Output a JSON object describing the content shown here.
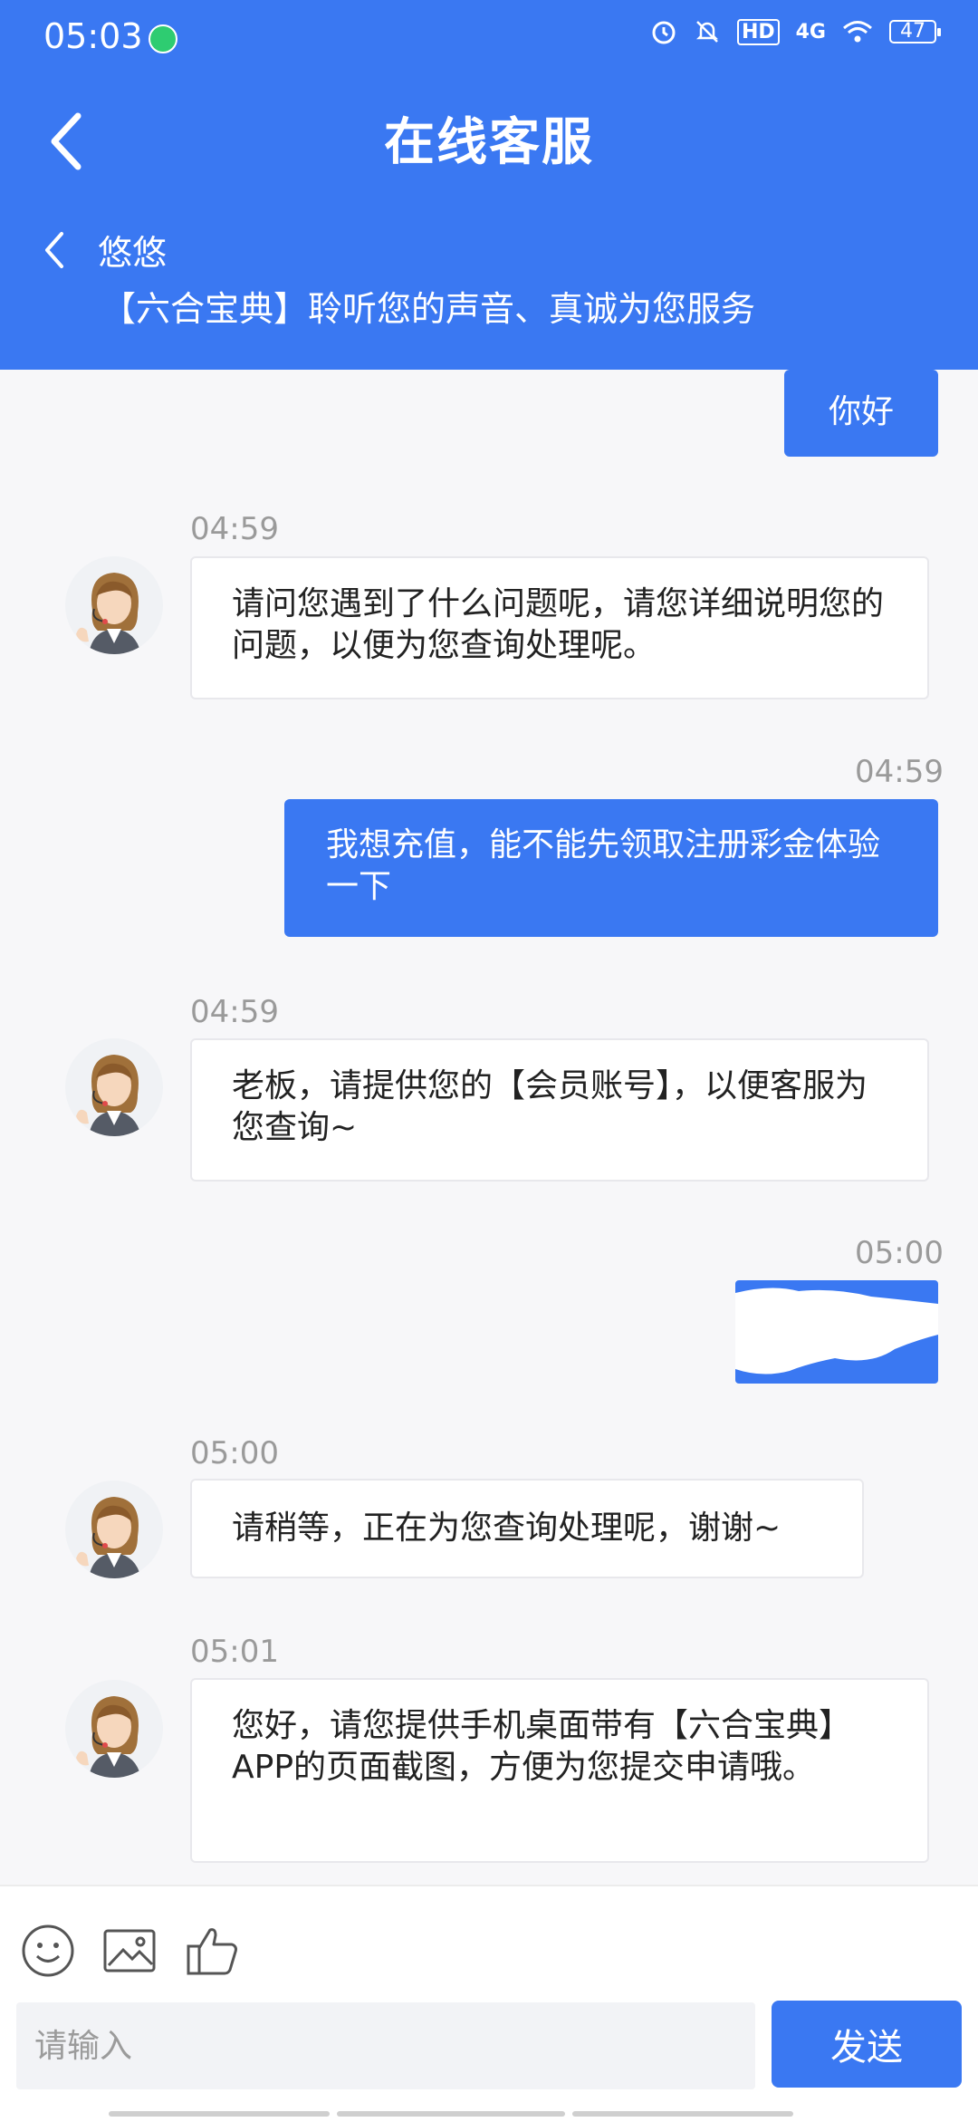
{
  "status_bar": {
    "time": "05:03",
    "battery": "47",
    "icons": [
      "alarm-icon",
      "mute-icon",
      "hd-icon",
      "signal-4g-icon",
      "wifi-icon",
      "battery-icon"
    ],
    "hd_label": "HD",
    "network_label": "4G"
  },
  "header": {
    "title": "在线客服",
    "agent_name": "悠悠",
    "tagline": "【六合宝典】聆听您的声音、真诚为您服务",
    "color": "#3a78f2"
  },
  "messages": [
    {
      "side": "out",
      "text": "你好"
    },
    {
      "side": "in",
      "time": "04:59",
      "text": "请问您遇到了什么问题呢，请您详细说明您的问题，以便为您查询处理呢。"
    },
    {
      "side": "out",
      "time": "04:59",
      "text": "我想充值，能不能先领取注册彩金体验一下"
    },
    {
      "side": "in",
      "time": "04:59",
      "text": "老板，请提供您的【会员账号】，以便客服为您查询~"
    },
    {
      "side": "out",
      "time": "05:00",
      "text": ""
    },
    {
      "side": "in",
      "time": "05:00",
      "text": "请稍等，正在为您查询处理呢，谢谢~"
    },
    {
      "side": "in",
      "time": "05:01",
      "text": "您好，请您提供手机桌面带有【六合宝典】APP的页面截图，方便为您提交申请哦。"
    }
  ],
  "composer": {
    "placeholder": "请输入",
    "send_label": "发送",
    "tools": [
      "emoji-icon",
      "image-icon",
      "thumbs-up-icon"
    ]
  }
}
